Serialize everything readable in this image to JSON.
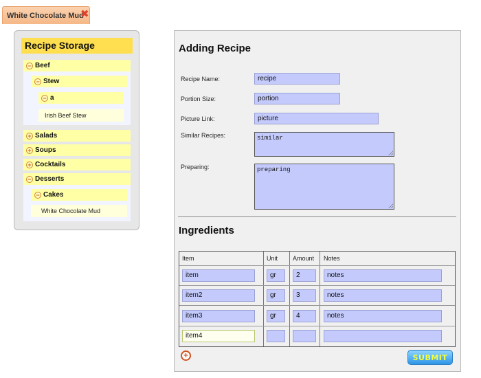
{
  "tab": {
    "label": "White Chocolate Mud",
    "close_icon": "close-icon"
  },
  "storage": {
    "title": "Recipe Storage",
    "tree": {
      "beef": "Beef",
      "stew": "Stew",
      "a": "a",
      "irish": "Irish Beef Stew",
      "salads": "Salads",
      "soups": "Soups",
      "cocktails": "Cocktails",
      "desserts": "Desserts",
      "cakes": "Cakes",
      "white_mud": "White Chocolate Mud"
    },
    "symbols": {
      "collapse": "⊖",
      "expand": "⊕"
    }
  },
  "form": {
    "title": "Adding Recipe",
    "name_label": "Recipe Name:",
    "name_value": "recipe",
    "portion_label": "Portion Size:",
    "portion_value": "portion",
    "picture_label": "Picture Link:",
    "picture_value": "picture",
    "similar_label": "Similar Recipes:",
    "similar_value": "similar",
    "preparing_label": "Preparing:",
    "preparing_value": "preparing"
  },
  "ingredients": {
    "title": "Ingredients",
    "columns": [
      "Item",
      "Unit",
      "Amount",
      "Notes"
    ],
    "rows": [
      {
        "item": "item",
        "unit": "gr",
        "amount": "2",
        "notes": "notes"
      },
      {
        "item": "item2",
        "unit": "gr",
        "amount": "3",
        "notes": "notes"
      },
      {
        "item": "item3",
        "unit": "gr",
        "amount": "4",
        "notes": "notes"
      },
      {
        "item": "item4",
        "unit": "",
        "amount": "",
        "notes": ""
      }
    ],
    "add_icon": "⊕",
    "submit_label": "SUBMIT"
  }
}
